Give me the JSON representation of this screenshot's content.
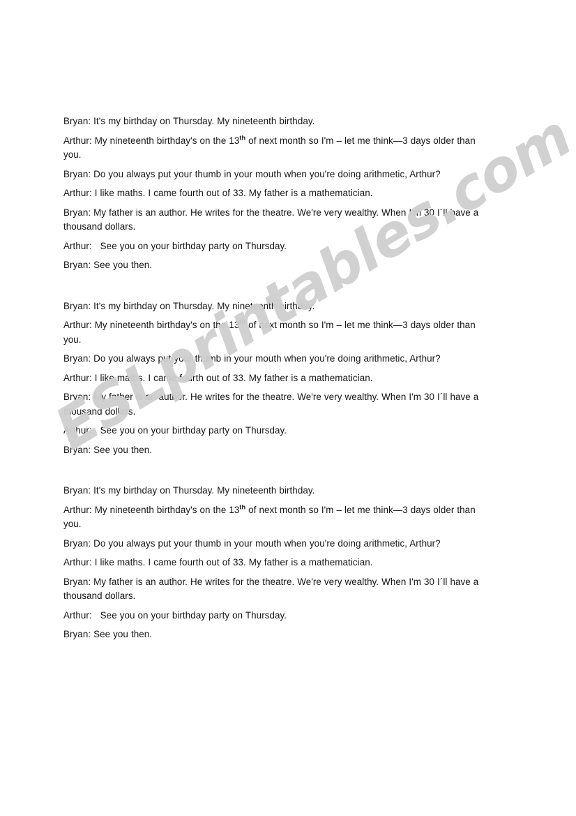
{
  "document": {
    "page_background": "#ffffff",
    "text_color": "#141414",
    "watermark": {
      "text": "ESLprintables.com",
      "color": "#cfcfcf",
      "rotation_degrees": -31
    },
    "blocks": [
      {
        "id": "dialogue-block-1",
        "lines": [
          {
            "speaker": "Bryan:",
            "gap": " ",
            "text": "It's my birthday on Thursday. My nineteenth birthday."
          },
          {
            "speaker": "Arthur:",
            "gap": " ",
            "pre": "My nineteenth birthday's on the 13",
            "sup": "th",
            "post": " of next month so I'm – let me think—3 days older than you."
          },
          {
            "speaker": "Bryan:",
            "gap": " ",
            "text": "Do you always put your thumb in your mouth when you're doing arithmetic, Arthur?"
          },
          {
            "speaker": "Arthur:",
            "gap": " ",
            "text": "I like maths. I came fourth out of 33. My father is a mathematician."
          },
          {
            "speaker": "Bryan:",
            "gap": " ",
            "text": "My father is an author. He writes for the theatre. We're very wealthy. When I'm 30 I´ll have a thousand dollars."
          },
          {
            "speaker": "Arthur:",
            "gap": "   ",
            "text": "See you on your birthday party on Thursday."
          },
          {
            "speaker": "Bryan:",
            "gap": " ",
            "text": "See you then."
          }
        ]
      },
      {
        "id": "dialogue-block-2",
        "lines": [
          {
            "speaker": "Bryan:",
            "gap": " ",
            "text": "It's my birthday on Thursday. My nineteenth birthday."
          },
          {
            "speaker": "Arthur:",
            "gap": " ",
            "pre": "My nineteenth birthday's on the 13",
            "sup": "th",
            "post": " of next month so I'm – let me think—3 days older than you."
          },
          {
            "speaker": "Bryan:",
            "gap": " ",
            "text": "Do you always put your thumb in your mouth when you're doing arithmetic, Arthur?"
          },
          {
            "speaker": "Arthur:",
            "gap": " ",
            "text": "I like maths. I came fourth out of 33. My father is a mathematician."
          },
          {
            "speaker": "Bryan:",
            "gap": " ",
            "text": "My father is an author. He writes for the theatre. We're very wealthy. When I'm 30 I´ll have a thousand dollars."
          },
          {
            "speaker": "Arthur:",
            "gap": "   ",
            "text": "See you on your birthday party on Thursday."
          },
          {
            "speaker": "Bryan:",
            "gap": " ",
            "text": "See you then."
          }
        ]
      },
      {
        "id": "dialogue-block-3",
        "lines": [
          {
            "speaker": "Bryan:",
            "gap": " ",
            "text": "It's my birthday on Thursday. My nineteenth birthday."
          },
          {
            "speaker": "Arthur:",
            "gap": " ",
            "pre": "My nineteenth birthday's on the 13",
            "sup": "th",
            "post": " of next month so I'm – let me think—3 days older than you."
          },
          {
            "speaker": "Bryan:",
            "gap": " ",
            "text": "Do you always put your thumb in your mouth when you're doing arithmetic, Arthur?"
          },
          {
            "speaker": "Arthur:",
            "gap": " ",
            "text": "I like maths. I came fourth out of 33. My father is a mathematician."
          },
          {
            "speaker": "Bryan:",
            "gap": " ",
            "text": "My father is an author. He writes for the theatre. We're very wealthy. When I'm 30 I´ll have a thousand dollars."
          },
          {
            "speaker": "Arthur:",
            "gap": "   ",
            "text": "See you on your birthday party on Thursday."
          },
          {
            "speaker": "Bryan:",
            "gap": " ",
            "text": "See you then."
          }
        ]
      }
    ]
  }
}
